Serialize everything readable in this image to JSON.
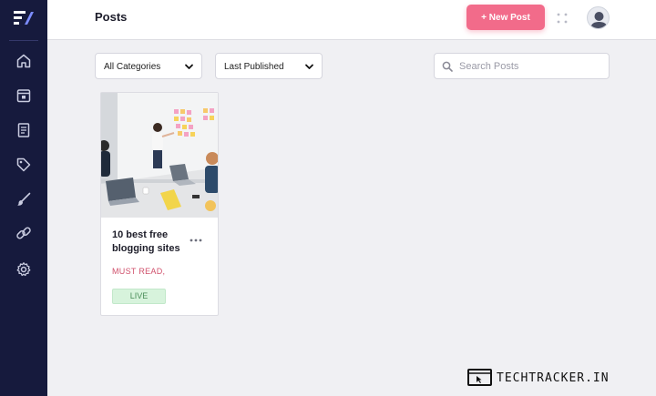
{
  "sidebar": {
    "logo": "brand-logo",
    "nav": [
      {
        "icon": "home-icon"
      },
      {
        "icon": "calendar-icon"
      },
      {
        "icon": "document-icon"
      },
      {
        "icon": "tag-icon"
      },
      {
        "icon": "brush-icon"
      },
      {
        "icon": "link-icon"
      },
      {
        "icon": "gear-icon"
      }
    ],
    "background": "#161a3d"
  },
  "header": {
    "title": "Posts",
    "new_post_label": "+ New Post",
    "accent": "#f26b8a"
  },
  "filters": {
    "category": "All Categories",
    "sort": "Last Published",
    "search_placeholder": "Search Posts",
    "search_value": ""
  },
  "posts": [
    {
      "title": "10 best free blogging sites",
      "category": "MUST READ,",
      "status": "LIVE"
    }
  ],
  "watermark": {
    "text": "TECHTRACKER.IN"
  }
}
